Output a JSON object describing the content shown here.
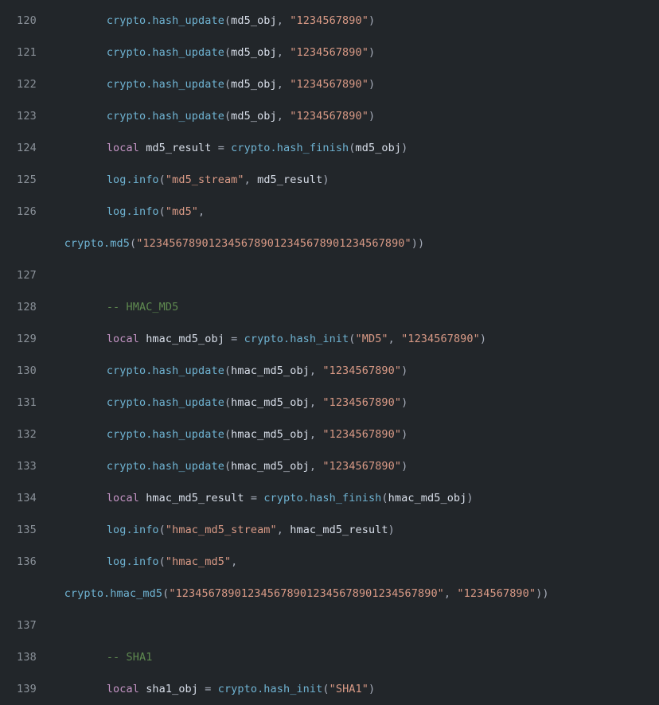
{
  "editor": {
    "language": "lua",
    "theme_background": "#22262a",
    "colors": {
      "background": "#22262a",
      "line_number": "#8a9199",
      "plain_text": "#d8dee9",
      "keyword": "#c594c5",
      "function": "#6fb3d2",
      "string": "#d99a86",
      "comment": "#5f8a50",
      "punctuation": "#a7adba"
    }
  },
  "lines": [
    {
      "number": "120",
      "indent": "        ",
      "tokens": [
        {
          "t": "fn",
          "v": "crypto.hash_update"
        },
        {
          "t": "punct",
          "v": "("
        },
        {
          "t": "plain",
          "v": "md5_obj"
        },
        {
          "t": "punct",
          "v": ", "
        },
        {
          "t": "str",
          "v": "\"1234567890\""
        },
        {
          "t": "punct",
          "v": ")"
        }
      ]
    },
    {
      "number": "121",
      "indent": "        ",
      "tokens": [
        {
          "t": "fn",
          "v": "crypto.hash_update"
        },
        {
          "t": "punct",
          "v": "("
        },
        {
          "t": "plain",
          "v": "md5_obj"
        },
        {
          "t": "punct",
          "v": ", "
        },
        {
          "t": "str",
          "v": "\"1234567890\""
        },
        {
          "t": "punct",
          "v": ")"
        }
      ]
    },
    {
      "number": "122",
      "indent": "        ",
      "tokens": [
        {
          "t": "fn",
          "v": "crypto.hash_update"
        },
        {
          "t": "punct",
          "v": "("
        },
        {
          "t": "plain",
          "v": "md5_obj"
        },
        {
          "t": "punct",
          "v": ", "
        },
        {
          "t": "str",
          "v": "\"1234567890\""
        },
        {
          "t": "punct",
          "v": ")"
        }
      ]
    },
    {
      "number": "123",
      "indent": "        ",
      "tokens": [
        {
          "t": "fn",
          "v": "crypto.hash_update"
        },
        {
          "t": "punct",
          "v": "("
        },
        {
          "t": "plain",
          "v": "md5_obj"
        },
        {
          "t": "punct",
          "v": ", "
        },
        {
          "t": "str",
          "v": "\"1234567890\""
        },
        {
          "t": "punct",
          "v": ")"
        }
      ]
    },
    {
      "number": "124",
      "indent": "        ",
      "tokens": [
        {
          "t": "kw",
          "v": "local"
        },
        {
          "t": "plain",
          "v": " md5_result "
        },
        {
          "t": "op",
          "v": "="
        },
        {
          "t": "plain",
          "v": " "
        },
        {
          "t": "fn",
          "v": "crypto.hash_finish"
        },
        {
          "t": "punct",
          "v": "("
        },
        {
          "t": "plain",
          "v": "md5_obj"
        },
        {
          "t": "punct",
          "v": ")"
        }
      ]
    },
    {
      "number": "125",
      "indent": "        ",
      "tokens": [
        {
          "t": "fn",
          "v": "log.info"
        },
        {
          "t": "punct",
          "v": "("
        },
        {
          "t": "str",
          "v": "\"md5_stream\""
        },
        {
          "t": "punct",
          "v": ", "
        },
        {
          "t": "plain",
          "v": "md5_result"
        },
        {
          "t": "punct",
          "v": ")"
        }
      ]
    },
    {
      "number": "126",
      "indent": "        ",
      "tokens": [
        {
          "t": "fn",
          "v": "log.info"
        },
        {
          "t": "punct",
          "v": "("
        },
        {
          "t": "str",
          "v": "\"md5\""
        },
        {
          "t": "punct",
          "v": ","
        }
      ]
    },
    {
      "number": "",
      "wrapped": true,
      "indent": "   ",
      "tokens": [
        {
          "t": "fn",
          "v": "crypto.md5"
        },
        {
          "t": "punct",
          "v": "("
        },
        {
          "t": "str",
          "v": "\"1234567890123456789012345678901234567890\""
        },
        {
          "t": "punct",
          "v": "))"
        }
      ]
    },
    {
      "number": "127",
      "indent": "",
      "tokens": []
    },
    {
      "number": "128",
      "indent": "        ",
      "tokens": [
        {
          "t": "com",
          "v": "-- HMAC_MD5"
        }
      ]
    },
    {
      "number": "129",
      "indent": "        ",
      "tokens": [
        {
          "t": "kw",
          "v": "local"
        },
        {
          "t": "plain",
          "v": " hmac_md5_obj "
        },
        {
          "t": "op",
          "v": "="
        },
        {
          "t": "plain",
          "v": " "
        },
        {
          "t": "fn",
          "v": "crypto.hash_init"
        },
        {
          "t": "punct",
          "v": "("
        },
        {
          "t": "str",
          "v": "\"MD5\""
        },
        {
          "t": "punct",
          "v": ", "
        },
        {
          "t": "str",
          "v": "\"1234567890\""
        },
        {
          "t": "punct",
          "v": ")"
        }
      ]
    },
    {
      "number": "130",
      "indent": "        ",
      "tokens": [
        {
          "t": "fn",
          "v": "crypto.hash_update"
        },
        {
          "t": "punct",
          "v": "("
        },
        {
          "t": "plain",
          "v": "hmac_md5_obj"
        },
        {
          "t": "punct",
          "v": ", "
        },
        {
          "t": "str",
          "v": "\"1234567890\""
        },
        {
          "t": "punct",
          "v": ")"
        }
      ]
    },
    {
      "number": "131",
      "indent": "        ",
      "tokens": [
        {
          "t": "fn",
          "v": "crypto.hash_update"
        },
        {
          "t": "punct",
          "v": "("
        },
        {
          "t": "plain",
          "v": "hmac_md5_obj"
        },
        {
          "t": "punct",
          "v": ", "
        },
        {
          "t": "str",
          "v": "\"1234567890\""
        },
        {
          "t": "punct",
          "v": ")"
        }
      ]
    },
    {
      "number": "132",
      "indent": "        ",
      "tokens": [
        {
          "t": "fn",
          "v": "crypto.hash_update"
        },
        {
          "t": "punct",
          "v": "("
        },
        {
          "t": "plain",
          "v": "hmac_md5_obj"
        },
        {
          "t": "punct",
          "v": ", "
        },
        {
          "t": "str",
          "v": "\"1234567890\""
        },
        {
          "t": "punct",
          "v": ")"
        }
      ]
    },
    {
      "number": "133",
      "indent": "        ",
      "tokens": [
        {
          "t": "fn",
          "v": "crypto.hash_update"
        },
        {
          "t": "punct",
          "v": "("
        },
        {
          "t": "plain",
          "v": "hmac_md5_obj"
        },
        {
          "t": "punct",
          "v": ", "
        },
        {
          "t": "str",
          "v": "\"1234567890\""
        },
        {
          "t": "punct",
          "v": ")"
        }
      ]
    },
    {
      "number": "134",
      "indent": "        ",
      "tokens": [
        {
          "t": "kw",
          "v": "local"
        },
        {
          "t": "plain",
          "v": " hmac_md5_result "
        },
        {
          "t": "op",
          "v": "="
        },
        {
          "t": "plain",
          "v": " "
        },
        {
          "t": "fn",
          "v": "crypto.hash_finish"
        },
        {
          "t": "punct",
          "v": "("
        },
        {
          "t": "plain",
          "v": "hmac_md5_obj"
        },
        {
          "t": "punct",
          "v": ")"
        }
      ]
    },
    {
      "number": "135",
      "indent": "        ",
      "tokens": [
        {
          "t": "fn",
          "v": "log.info"
        },
        {
          "t": "punct",
          "v": "("
        },
        {
          "t": "str",
          "v": "\"hmac_md5_stream\""
        },
        {
          "t": "punct",
          "v": ", "
        },
        {
          "t": "plain",
          "v": "hmac_md5_result"
        },
        {
          "t": "punct",
          "v": ")"
        }
      ]
    },
    {
      "number": "136",
      "indent": "        ",
      "tokens": [
        {
          "t": "fn",
          "v": "log.info"
        },
        {
          "t": "punct",
          "v": "("
        },
        {
          "t": "str",
          "v": "\"hmac_md5\""
        },
        {
          "t": "punct",
          "v": ","
        }
      ]
    },
    {
      "number": "",
      "wrapped": true,
      "indent": "   ",
      "tokens": [
        {
          "t": "fn",
          "v": "crypto.hmac_md5"
        },
        {
          "t": "punct",
          "v": "("
        },
        {
          "t": "str",
          "v": "\"1234567890123456789012345678901234567890\""
        },
        {
          "t": "punct",
          "v": ", "
        },
        {
          "t": "str",
          "v": "\"1234567890\""
        },
        {
          "t": "punct",
          "v": "))"
        }
      ]
    },
    {
      "number": "137",
      "indent": "",
      "tokens": []
    },
    {
      "number": "138",
      "indent": "        ",
      "tokens": [
        {
          "t": "com",
          "v": "-- SHA1"
        }
      ]
    },
    {
      "number": "139",
      "indent": "        ",
      "tokens": [
        {
          "t": "kw",
          "v": "local"
        },
        {
          "t": "plain",
          "v": " sha1_obj "
        },
        {
          "t": "op",
          "v": "="
        },
        {
          "t": "plain",
          "v": " "
        },
        {
          "t": "fn",
          "v": "crypto.hash_init"
        },
        {
          "t": "punct",
          "v": "("
        },
        {
          "t": "str",
          "v": "\"SHA1\""
        },
        {
          "t": "punct",
          "v": ")"
        }
      ]
    }
  ]
}
